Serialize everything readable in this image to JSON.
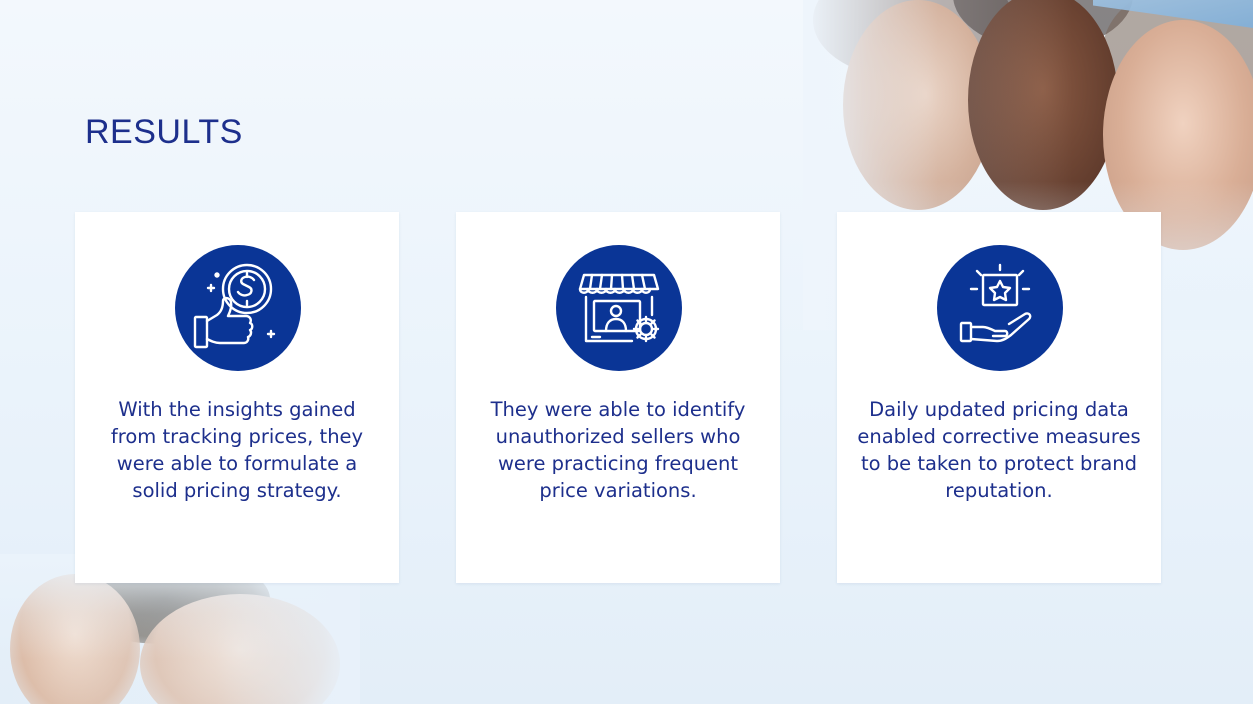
{
  "slide": {
    "title": "RESULTS"
  },
  "cards": [
    {
      "icon": "thumbs-up-dollar-icon",
      "text": "With the insights gained from tracking prices, they were able to formulate a solid pricing strategy."
    },
    {
      "icon": "storefront-seller-gear-icon",
      "text": "They were able to identify unauthorized sellers who were practicing frequent price variations."
    },
    {
      "icon": "hand-star-frame-icon",
      "text": "Daily updated pricing data enabled corrective measures to be taken to protect brand reputation."
    }
  ],
  "colors": {
    "accent": "#0a3596",
    "text": "#1d2f8c",
    "background": "#eaf3fb",
    "card": "#ffffff"
  }
}
